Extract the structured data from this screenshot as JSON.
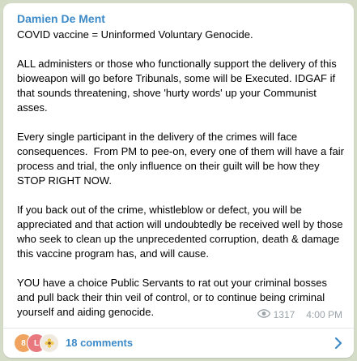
{
  "message": {
    "author": "Damien De Ment",
    "paragraphs": [
      "COVID vaccine = Uninformed Voluntary Genocide.",
      "ALL administers or those who functionally support the delivery of this bioweapon will go before Tribunals, some will be Executed. IDGAF if that sounds threatening, shove 'hurty words' up your Communist asses.",
      "Every single participant in the delivery of the crimes will face consequences.  From PM to pee-on, every one of them will have a fair process and trial, the only influence on their guilt will be how they STOP RIGHT NOW.",
      "If you back out of the crime, whistleblow or defect, you will be appreciated and that action will undoubtedly be received well by those who seek to clean up the unprecedented corruption, death & damage this vaccine program has, and will cause.",
      "YOU have a choice Public Servants to rat out your criminal bosses and pull back their thin veil of control, or to continue being criminal yourself and aiding genocide."
    ],
    "views": "1317",
    "time": "4:00 PM",
    "view_icon": "eye-icon"
  },
  "comments": {
    "label": "18 comments",
    "avatars": [
      {
        "initial": "8",
        "color": "#f0a35e"
      },
      {
        "initial": "L",
        "color": "#e8787d"
      },
      {
        "initial": "",
        "color": "#efe9e0"
      }
    ],
    "chevron_icon": "chevron-right-icon"
  },
  "colors": {
    "background": "#d4dcc8",
    "accent": "#3d8ac8",
    "meta": "#9aa3a8"
  }
}
